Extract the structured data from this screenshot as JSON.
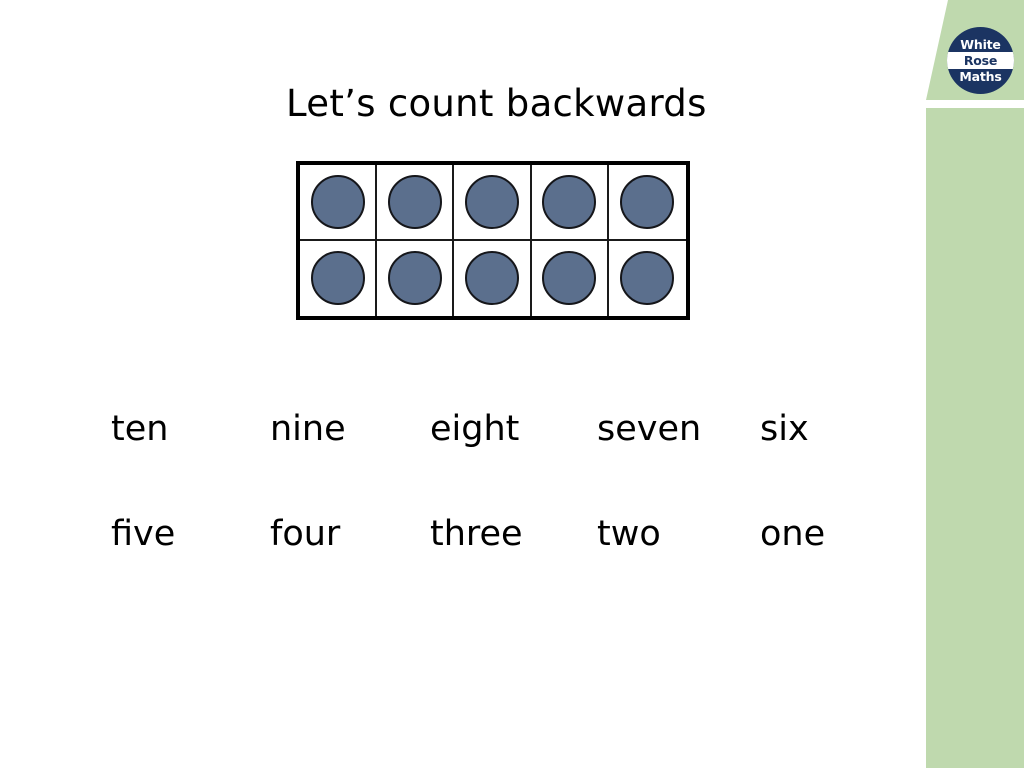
{
  "slide": {
    "title": "Let’s count backwards",
    "background_color": "#ffffff"
  },
  "brand": {
    "logo_name": "white-rose-maths-logo",
    "line1": "White",
    "line2": "Rose",
    "line3": "Maths",
    "navy": "#1b3462",
    "panel_green": "#bfd9ae"
  },
  "ten_frame": {
    "rows": 2,
    "columns": 5,
    "total_counters": 10,
    "counter_color": "#5b6f8d",
    "counter_outline": "#15161a",
    "cells": [
      [
        true,
        true,
        true,
        true,
        true
      ],
      [
        true,
        true,
        true,
        true,
        true
      ]
    ]
  },
  "number_words": {
    "row1": [
      "ten",
      "nine",
      "eight",
      "seven",
      "six"
    ],
    "row2": [
      "five",
      "four",
      "three",
      "two",
      "one"
    ]
  }
}
